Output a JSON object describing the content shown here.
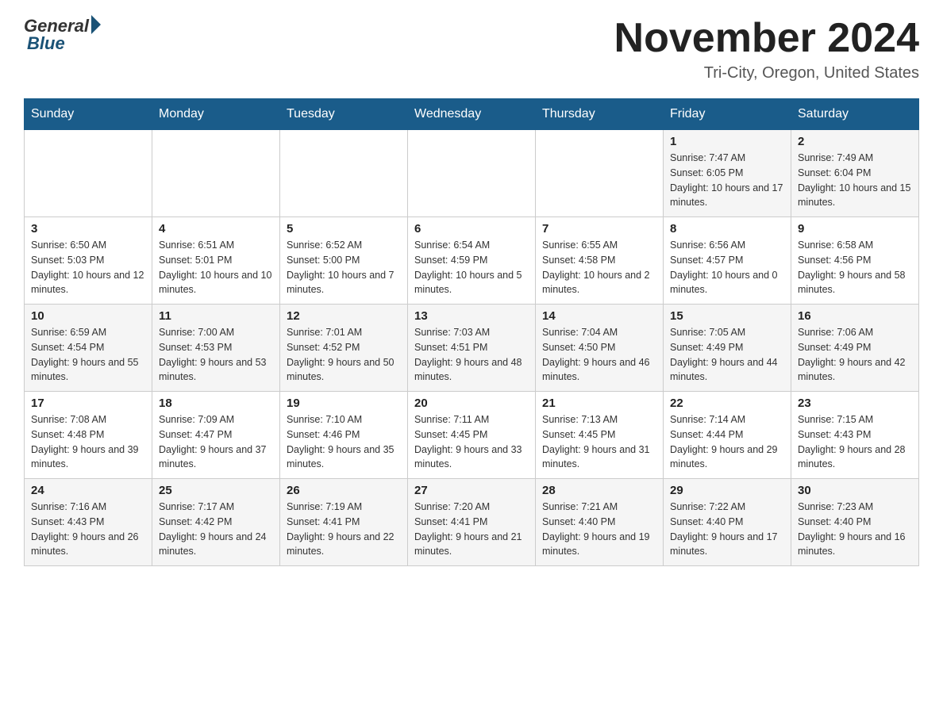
{
  "header": {
    "logo_general": "General",
    "logo_blue": "Blue",
    "month_title": "November 2024",
    "location": "Tri-City, Oregon, United States"
  },
  "days_of_week": [
    "Sunday",
    "Monday",
    "Tuesday",
    "Wednesday",
    "Thursday",
    "Friday",
    "Saturday"
  ],
  "weeks": [
    [
      {
        "day": "",
        "info": ""
      },
      {
        "day": "",
        "info": ""
      },
      {
        "day": "",
        "info": ""
      },
      {
        "day": "",
        "info": ""
      },
      {
        "day": "",
        "info": ""
      },
      {
        "day": "1",
        "info": "Sunrise: 7:47 AM\nSunset: 6:05 PM\nDaylight: 10 hours and 17 minutes."
      },
      {
        "day": "2",
        "info": "Sunrise: 7:49 AM\nSunset: 6:04 PM\nDaylight: 10 hours and 15 minutes."
      }
    ],
    [
      {
        "day": "3",
        "info": "Sunrise: 6:50 AM\nSunset: 5:03 PM\nDaylight: 10 hours and 12 minutes."
      },
      {
        "day": "4",
        "info": "Sunrise: 6:51 AM\nSunset: 5:01 PM\nDaylight: 10 hours and 10 minutes."
      },
      {
        "day": "5",
        "info": "Sunrise: 6:52 AM\nSunset: 5:00 PM\nDaylight: 10 hours and 7 minutes."
      },
      {
        "day": "6",
        "info": "Sunrise: 6:54 AM\nSunset: 4:59 PM\nDaylight: 10 hours and 5 minutes."
      },
      {
        "day": "7",
        "info": "Sunrise: 6:55 AM\nSunset: 4:58 PM\nDaylight: 10 hours and 2 minutes."
      },
      {
        "day": "8",
        "info": "Sunrise: 6:56 AM\nSunset: 4:57 PM\nDaylight: 10 hours and 0 minutes."
      },
      {
        "day": "9",
        "info": "Sunrise: 6:58 AM\nSunset: 4:56 PM\nDaylight: 9 hours and 58 minutes."
      }
    ],
    [
      {
        "day": "10",
        "info": "Sunrise: 6:59 AM\nSunset: 4:54 PM\nDaylight: 9 hours and 55 minutes."
      },
      {
        "day": "11",
        "info": "Sunrise: 7:00 AM\nSunset: 4:53 PM\nDaylight: 9 hours and 53 minutes."
      },
      {
        "day": "12",
        "info": "Sunrise: 7:01 AM\nSunset: 4:52 PM\nDaylight: 9 hours and 50 minutes."
      },
      {
        "day": "13",
        "info": "Sunrise: 7:03 AM\nSunset: 4:51 PM\nDaylight: 9 hours and 48 minutes."
      },
      {
        "day": "14",
        "info": "Sunrise: 7:04 AM\nSunset: 4:50 PM\nDaylight: 9 hours and 46 minutes."
      },
      {
        "day": "15",
        "info": "Sunrise: 7:05 AM\nSunset: 4:49 PM\nDaylight: 9 hours and 44 minutes."
      },
      {
        "day": "16",
        "info": "Sunrise: 7:06 AM\nSunset: 4:49 PM\nDaylight: 9 hours and 42 minutes."
      }
    ],
    [
      {
        "day": "17",
        "info": "Sunrise: 7:08 AM\nSunset: 4:48 PM\nDaylight: 9 hours and 39 minutes."
      },
      {
        "day": "18",
        "info": "Sunrise: 7:09 AM\nSunset: 4:47 PM\nDaylight: 9 hours and 37 minutes."
      },
      {
        "day": "19",
        "info": "Sunrise: 7:10 AM\nSunset: 4:46 PM\nDaylight: 9 hours and 35 minutes."
      },
      {
        "day": "20",
        "info": "Sunrise: 7:11 AM\nSunset: 4:45 PM\nDaylight: 9 hours and 33 minutes."
      },
      {
        "day": "21",
        "info": "Sunrise: 7:13 AM\nSunset: 4:45 PM\nDaylight: 9 hours and 31 minutes."
      },
      {
        "day": "22",
        "info": "Sunrise: 7:14 AM\nSunset: 4:44 PM\nDaylight: 9 hours and 29 minutes."
      },
      {
        "day": "23",
        "info": "Sunrise: 7:15 AM\nSunset: 4:43 PM\nDaylight: 9 hours and 28 minutes."
      }
    ],
    [
      {
        "day": "24",
        "info": "Sunrise: 7:16 AM\nSunset: 4:43 PM\nDaylight: 9 hours and 26 minutes."
      },
      {
        "day": "25",
        "info": "Sunrise: 7:17 AM\nSunset: 4:42 PM\nDaylight: 9 hours and 24 minutes."
      },
      {
        "day": "26",
        "info": "Sunrise: 7:19 AM\nSunset: 4:41 PM\nDaylight: 9 hours and 22 minutes."
      },
      {
        "day": "27",
        "info": "Sunrise: 7:20 AM\nSunset: 4:41 PM\nDaylight: 9 hours and 21 minutes."
      },
      {
        "day": "28",
        "info": "Sunrise: 7:21 AM\nSunset: 4:40 PM\nDaylight: 9 hours and 19 minutes."
      },
      {
        "day": "29",
        "info": "Sunrise: 7:22 AM\nSunset: 4:40 PM\nDaylight: 9 hours and 17 minutes."
      },
      {
        "day": "30",
        "info": "Sunrise: 7:23 AM\nSunset: 4:40 PM\nDaylight: 9 hours and 16 minutes."
      }
    ]
  ]
}
